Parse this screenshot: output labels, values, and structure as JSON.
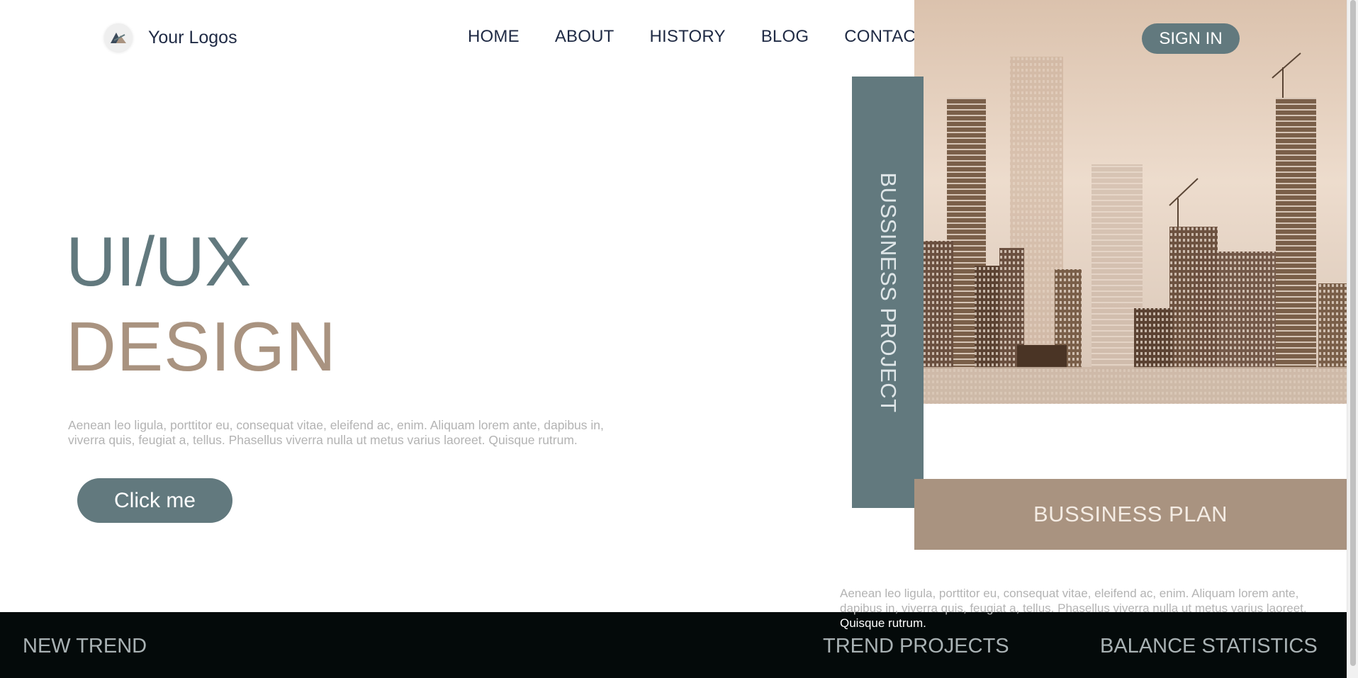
{
  "brand": {
    "logo_text": "Your Logos"
  },
  "nav": {
    "items": [
      "HOME",
      "ABOUT",
      "HISTORY",
      "BLOG",
      "CONTACT"
    ]
  },
  "header": {
    "signin_label": "SIGN IN"
  },
  "hero": {
    "title_line1": "UI/UX",
    "title_line2": "DESIGN",
    "description": "Aenean leo ligula, porttitor eu, consequat vitae, eleifend ac, enim. Aliquam lorem ante, dapibus in, viverra quis, feugiat a, tellus. Phasellus viverra nulla ut metus varius laoreet. Quisque rutrum.",
    "cta_label": "Click me"
  },
  "side": {
    "vertical_label": "BUSSINESS PROJECT",
    "plan_label": "BUSSINESS PLAN",
    "description_main": "Aenean leo ligula, porttitor eu, consequat vitae, eleifend ac, enim. Aliquam lorem ante, dapibus in, viverra quis, feugiat a, tellus. Phasellus viverra nulla ut metus varius laoreet.",
    "description_tail": "Quisque rutrum."
  },
  "footer": {
    "items": [
      "NEW TREND",
      "TREND PROJECTS",
      "BALANCE STATISTICS"
    ]
  },
  "colors": {
    "slate": "#62797e",
    "sand": "#a99380",
    "navy_text": "#1f2a44",
    "footer_bg": "#040a0a"
  },
  "icons": {
    "logo": "logo-mark-icon",
    "hero_image": "city-skyline-illustration"
  }
}
